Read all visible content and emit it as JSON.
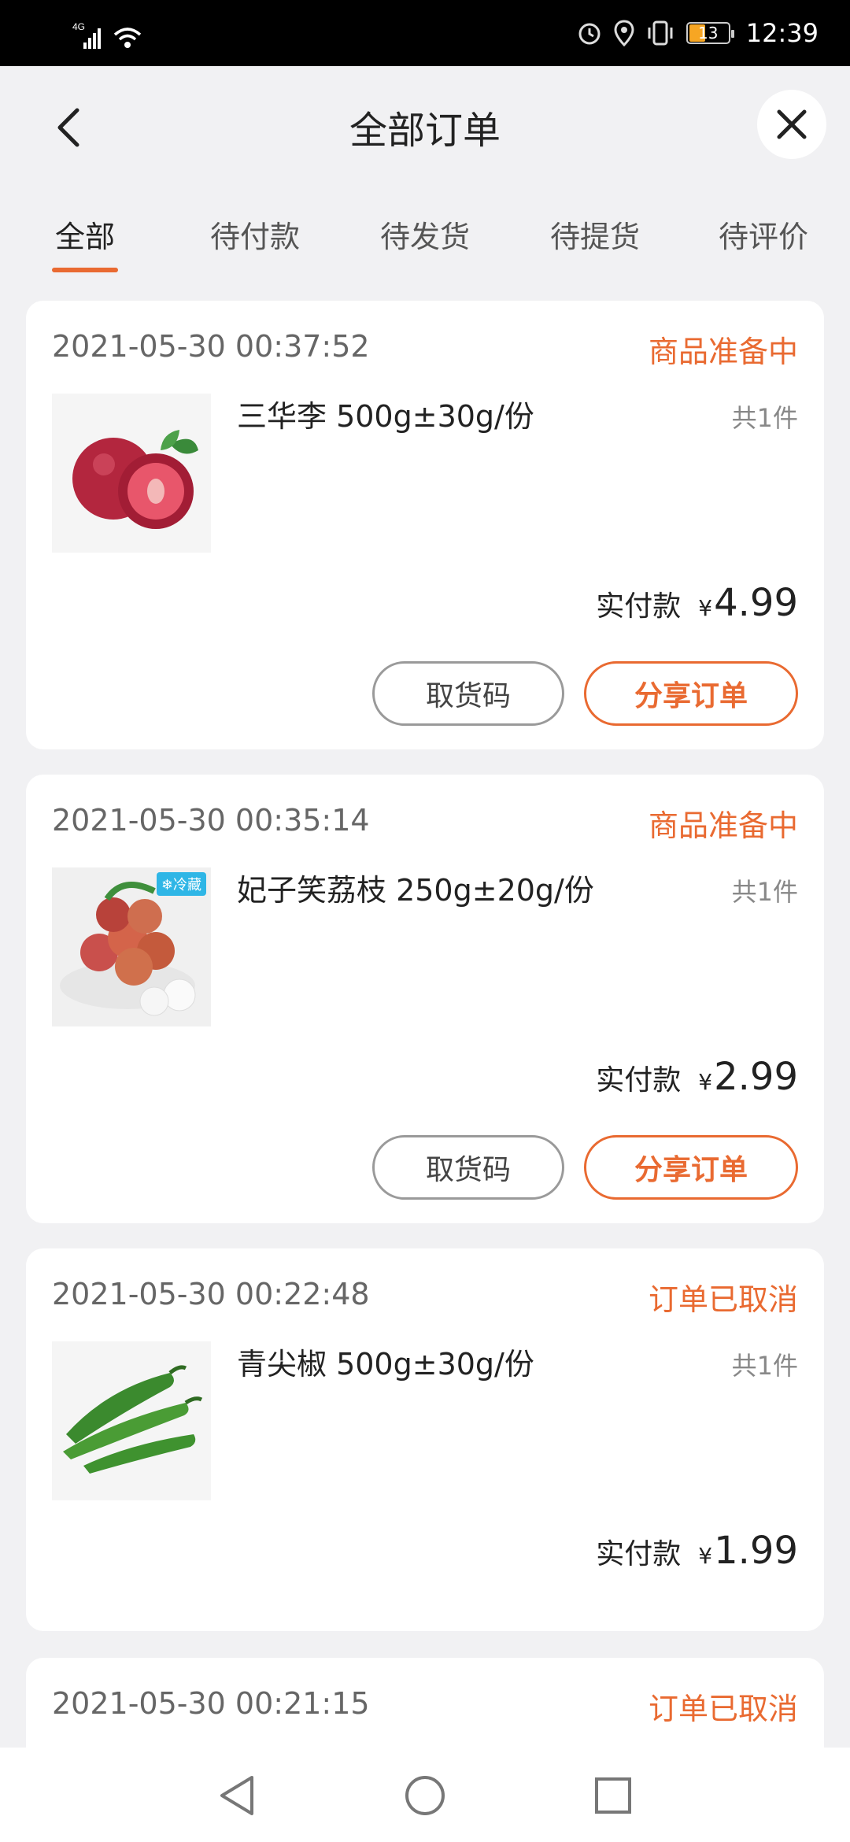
{
  "status_bar": {
    "network": "4G",
    "battery": "13",
    "time": "12:39",
    "icons": [
      "signal-icon",
      "wifi-icon",
      "alarm-icon",
      "location-icon",
      "vibrate-icon",
      "battery-icon"
    ]
  },
  "header": {
    "title": "全部订单",
    "back_icon": "chevron-left-icon",
    "close_icon": "close-icon"
  },
  "tabs": [
    {
      "label": "全部",
      "active": true
    },
    {
      "label": "待付款",
      "active": false
    },
    {
      "label": "待发货",
      "active": false
    },
    {
      "label": "待提货",
      "active": false
    },
    {
      "label": "待评价",
      "active": false
    }
  ],
  "labels": {
    "paid": "实付款",
    "yen": "¥",
    "pickup_code": "取货码",
    "share_order": "分享订单",
    "cold_badge": "❄冷藏"
  },
  "orders": [
    {
      "time": "2021-05-30 00:37:52",
      "status": "商品准备中",
      "product": "三华李 500g±30g/份",
      "qty": "共1件",
      "amount": "4.99",
      "thumb": "plum-image"
    },
    {
      "time": "2021-05-30 00:35:14",
      "status": "商品准备中",
      "product": "妃子笑荔枝 250g±20g/份",
      "qty": "共1件",
      "amount": "2.99",
      "thumb": "lychee-image"
    },
    {
      "time": "2021-05-30 00:22:48",
      "status": "订单已取消",
      "product": "青尖椒 500g±30g/份",
      "qty": "共1件",
      "amount": "1.99",
      "thumb": "green-pepper-image"
    },
    {
      "time": "2021-05-30 00:21:15",
      "status": "订单已取消"
    }
  ],
  "colors": {
    "accent": "#e96a31",
    "background": "#f1f1f3",
    "card": "#ffffff"
  },
  "nav_bar": {
    "icons": [
      "back-triangle-icon",
      "home-circle-icon",
      "recents-square-icon"
    ]
  }
}
